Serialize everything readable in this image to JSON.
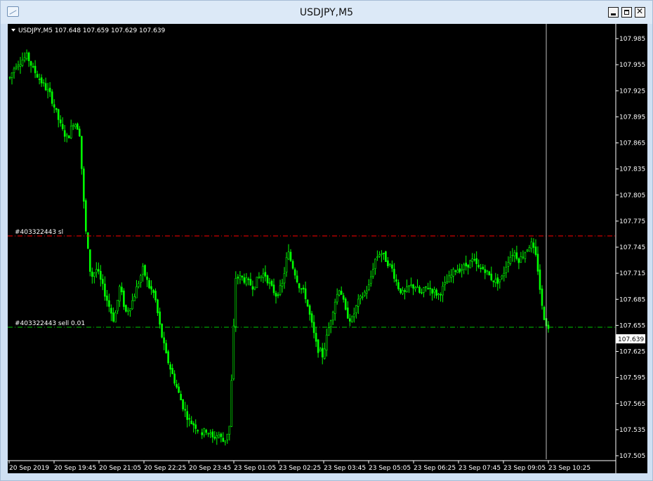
{
  "window": {
    "title": "USDJPY,M5"
  },
  "chart_header": {
    "text": "USDJPY,M5  107.648 107.659 107.629 107.639"
  },
  "orders": {
    "sl_label": "#403322443 sl",
    "entry_label": "#403322443 sell 0.01"
  },
  "colors": {
    "background": "#000000",
    "candle": "#00ff00",
    "stop_loss_line": "#ff0000",
    "entry_line": "#00c800",
    "axis_text": "#ffffff"
  },
  "chart_data": {
    "type": "candlestick",
    "symbol": "USDJPY",
    "timeframe": "M5",
    "last_price": "107.639",
    "ohlc_last": {
      "open": 107.648,
      "high": 107.659,
      "low": 107.629,
      "close": 107.639
    },
    "y_ticks": [
      "107.985",
      "107.955",
      "107.925",
      "107.895",
      "107.865",
      "107.835",
      "107.805",
      "107.775",
      "107.745",
      "107.715",
      "107.685",
      "107.655",
      "107.625",
      "107.595",
      "107.565",
      "107.535",
      "107.505"
    ],
    "x_ticks": [
      "20 Sep 2019",
      "20 Sep 19:45",
      "20 Sep 21:05",
      "20 Sep 22:25",
      "20 Sep 23:45",
      "23 Sep 01:05",
      "23 Sep 02:25",
      "23 Sep 03:45",
      "23 Sep 05:05",
      "23 Sep 06:25",
      "23 Sep 07:45",
      "23 Sep 09:05",
      "23 Sep 10:25"
    ],
    "levels": {
      "stop_loss": 107.76,
      "entry": 107.652
    },
    "series": [
      {
        "name": "USDJPY,M5",
        "close_path": [
          107.94,
          107.955,
          107.96,
          107.965,
          107.95,
          107.94,
          107.93,
          107.92,
          107.9,
          107.88,
          107.87,
          107.89,
          107.88,
          107.77,
          107.71,
          107.72,
          107.7,
          107.68,
          107.66,
          107.7,
          107.67,
          107.68,
          107.7,
          107.72,
          107.7,
          107.69,
          107.65,
          107.62,
          107.6,
          107.58,
          107.56,
          107.545,
          107.54,
          107.53,
          107.535,
          107.525,
          107.53,
          107.52,
          107.54,
          107.71,
          107.71,
          107.705,
          107.7,
          107.71,
          107.715,
          107.7,
          107.69,
          107.7,
          107.74,
          107.72,
          107.7,
          107.69,
          107.66,
          107.63,
          107.62,
          107.65,
          107.68,
          107.7,
          107.67,
          107.66,
          107.68,
          107.69,
          107.7,
          107.73,
          107.74,
          107.73,
          107.72,
          107.7,
          107.69,
          107.7,
          107.7,
          107.69,
          107.7,
          107.695,
          107.69,
          107.7,
          107.71,
          107.72,
          107.72,
          107.725,
          107.73,
          107.72,
          107.72,
          107.71,
          107.705,
          107.71,
          107.73,
          107.74,
          107.73,
          107.74,
          107.75,
          107.73,
          107.67,
          107.65
        ]
      }
    ]
  }
}
